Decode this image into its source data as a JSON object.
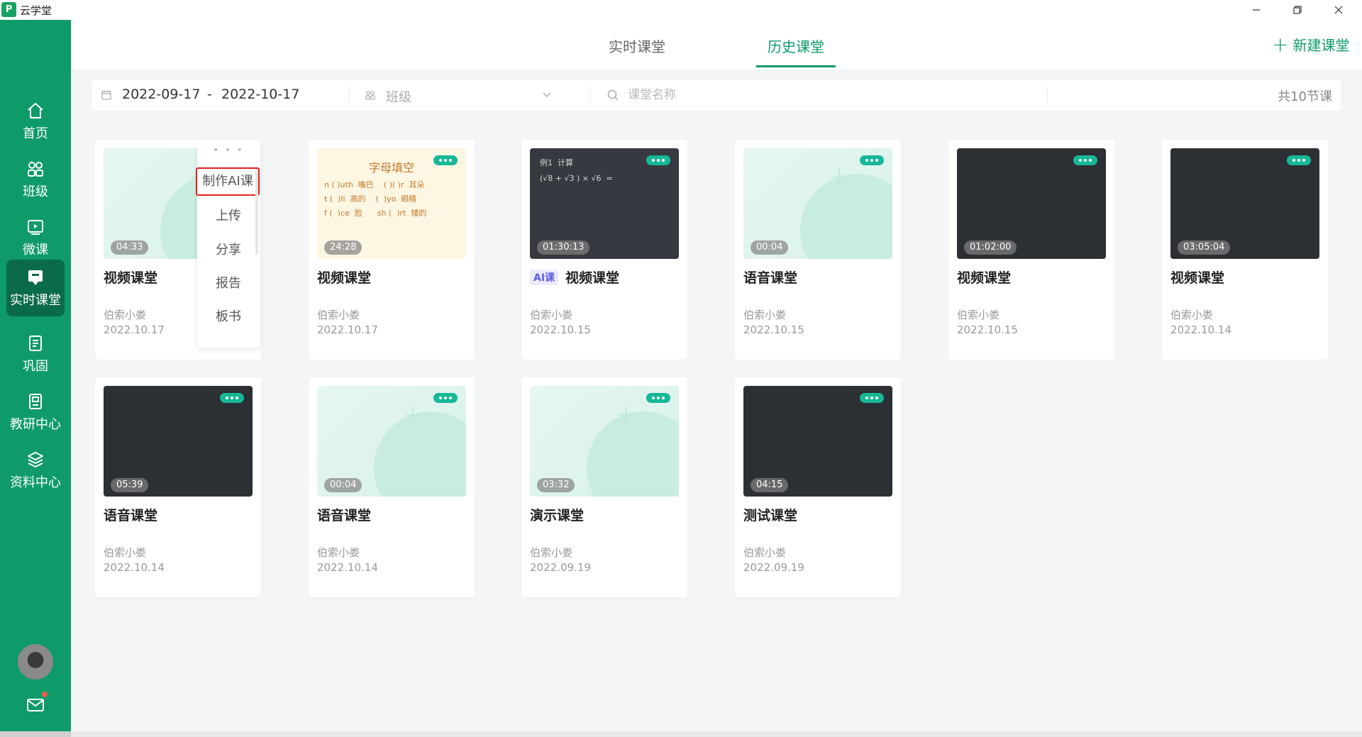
{
  "window": {
    "title": "云学堂"
  },
  "sidebar": {
    "items": [
      {
        "label": "首页",
        "icon": "home-icon"
      },
      {
        "label": "班级",
        "icon": "class-group-icon"
      },
      {
        "label": "微课",
        "icon": "micro-lesson-icon"
      },
      {
        "label": "实时课堂",
        "icon": "live-classroom-icon"
      },
      {
        "label": "巩固",
        "icon": "consolidate-icon"
      },
      {
        "label": "教研中心",
        "icon": "research-center-icon"
      },
      {
        "label": "资料中心",
        "icon": "resource-center-icon"
      }
    ],
    "active_index": 3
  },
  "header": {
    "tabs": [
      {
        "label": "实时课堂"
      },
      {
        "label": "历史课堂"
      }
    ],
    "active_tab": 1,
    "new_class_label": "新建课堂"
  },
  "filter": {
    "date_start": "2022-09-17",
    "date_separator": "-",
    "date_end": "2022-10-17",
    "class_placeholder": "班级",
    "search_placeholder": "课堂名称",
    "count_text": "共10节课"
  },
  "menu": {
    "items": [
      "制作AI课",
      "上传",
      "分享",
      "报告",
      "板书"
    ]
  },
  "cards": [
    {
      "title": "视频课堂",
      "author": "伯索小娄",
      "date": "2022.10.17",
      "duration": "04:33",
      "thumb": "mint",
      "ai": ""
    },
    {
      "title": "视频课堂",
      "author": "伯索小娄",
      "date": "2022.10.17",
      "duration": "24:28",
      "thumb": "letters",
      "ai": ""
    },
    {
      "title": "视频课堂",
      "author": "伯索小娄",
      "date": "2022.10.15",
      "duration": "01:30:13",
      "thumb": "math",
      "ai": "AI课"
    },
    {
      "title": "语音课堂",
      "author": "伯索小娄",
      "date": "2022.10.15",
      "duration": "00:04",
      "thumb": "mint",
      "ai": ""
    },
    {
      "title": "视频课堂",
      "author": "伯索小娄",
      "date": "2022.10.15",
      "duration": "01:02:00",
      "thumb": "dark",
      "ai": ""
    },
    {
      "title": "视频课堂",
      "author": "伯索小娄",
      "date": "2022.10.14",
      "duration": "03:05:04",
      "thumb": "dark",
      "ai": ""
    },
    {
      "title": "语音课堂",
      "author": "伯索小娄",
      "date": "2022.10.14",
      "duration": "05:39",
      "thumb": "dark",
      "ai": ""
    },
    {
      "title": "语音课堂",
      "author": "伯索小娄",
      "date": "2022.10.14",
      "duration": "00:04",
      "thumb": "mint",
      "ai": ""
    },
    {
      "title": "演示课堂",
      "author": "伯索小娄",
      "date": "2022.09.19",
      "duration": "03:32",
      "thumb": "mint",
      "ai": ""
    },
    {
      "title": "测试课堂",
      "author": "伯索小娄",
      "date": "2022.09.19",
      "duration": "04:15",
      "thumb": "dark",
      "ai": ""
    }
  ],
  "thumb_letters": {
    "title": "字母填空",
    "lines": "n ( )uth  嘴巴    ( )( )r  耳朵\nt (  )ll  高的    (  )yo  眼睛\nf (  )ce  脸      sh (  )rt  矮的"
  },
  "thumb_math": {
    "lines": "例1  计算\n(√8 + √3 ) × √6  ="
  },
  "colors": {
    "brand": "#0f9a6a",
    "sidebar_active": "#0a6b49",
    "accent_pill": "#17b897",
    "highlight_border": "#e0201d"
  }
}
